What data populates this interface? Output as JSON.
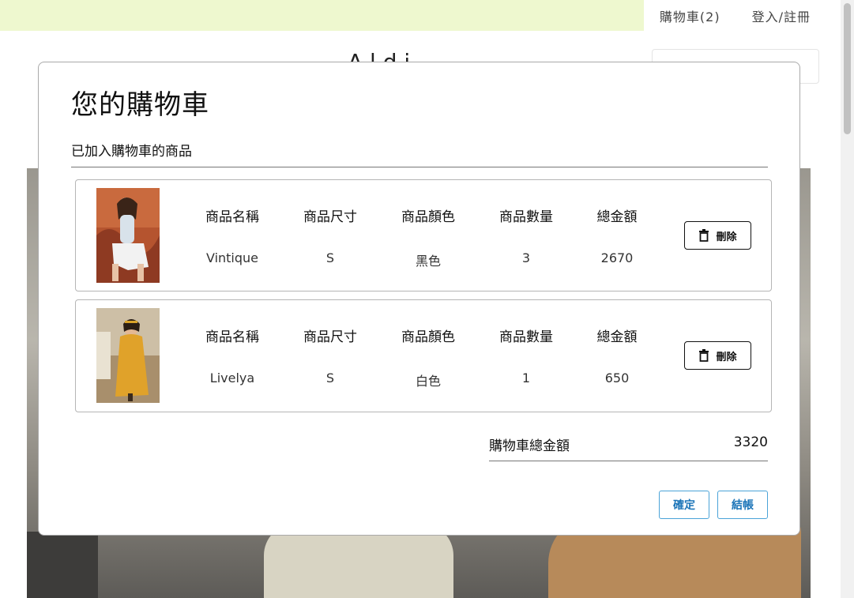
{
  "nav": {
    "cart": "購物車(2)",
    "login": "登入/註冊"
  },
  "background": {
    "logo": "A   l   d   i"
  },
  "modal": {
    "title": "您的購物車",
    "section_label": "已加入購物車的商品",
    "column_headers": [
      "商品名稱",
      "商品尺寸",
      "商品顏色",
      "商品數量",
      "總金額"
    ],
    "items": [
      {
        "name": "Vintique",
        "size": "S",
        "color": "黑色",
        "quantity": "3",
        "total": "2670",
        "delete_label": "刪除"
      },
      {
        "name": "Livelya",
        "size": "S",
        "color": "白色",
        "quantity": "1",
        "total": "650",
        "delete_label": "刪除"
      }
    ],
    "cart_total_label": "購物車總金額",
    "cart_total_value": "3320",
    "confirm_label": "確定",
    "checkout_label": "結帳"
  },
  "colors": {
    "topbar": "#eef8cf",
    "button_accent": "#1b74b8"
  }
}
